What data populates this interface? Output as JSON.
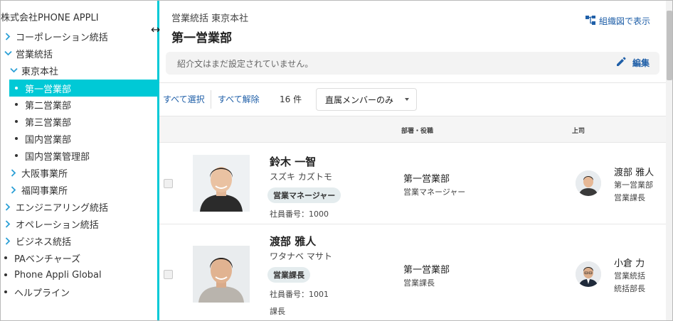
{
  "colors": {
    "accent": "#00c9d6",
    "link": "#1f5fa8",
    "badge_bg": "#e4ecee"
  },
  "sidebar": {
    "root": "株式会社PHONE APPLI",
    "items": [
      {
        "label": "コーポレーション統括",
        "kind": "collapsed"
      },
      {
        "label": "営業統括",
        "kind": "expanded"
      },
      {
        "label": "東京本社",
        "kind": "expanded"
      },
      {
        "label": "第一営業部",
        "kind": "leaf",
        "active": true
      },
      {
        "label": "第二営業部",
        "kind": "leaf"
      },
      {
        "label": "第三営業部",
        "kind": "leaf"
      },
      {
        "label": "国内営業部",
        "kind": "leaf"
      },
      {
        "label": "国内営業管理部",
        "kind": "leaf"
      },
      {
        "label": "大阪事業所",
        "kind": "collapsed"
      },
      {
        "label": "福岡事業所",
        "kind": "collapsed"
      },
      {
        "label": "エンジニアリング統括",
        "kind": "collapsed"
      },
      {
        "label": "オペレーション統括",
        "kind": "collapsed"
      },
      {
        "label": "ビジネス統括",
        "kind": "collapsed"
      },
      {
        "label": "PAベンチャーズ",
        "kind": "leaf"
      },
      {
        "label": "Phone Appli Global",
        "kind": "leaf"
      },
      {
        "label": "ヘルプライン",
        "kind": "leaf"
      }
    ]
  },
  "header": {
    "breadcrumb": "営業統括 東京本社",
    "title": "第一営業部",
    "org_chart_link": "組織図で表示"
  },
  "intro": {
    "text": "紹介文はまだ設定されていません。",
    "edit_label": "編集"
  },
  "toolbar": {
    "select_all": "すべて選択",
    "clear_all": "すべて解除",
    "count": "16 件",
    "filter_value": "直属メンバーのみ"
  },
  "table": {
    "headers": {
      "dept_role": "部署・役職",
      "manager": "上司"
    },
    "rows": [
      {
        "name": "鈴木 一智",
        "kana": "スズキ カズトモ",
        "role_badge": "営業マネージャー",
        "employee_no": "社員番号：1000",
        "extra": "",
        "dept": "第一営業部",
        "position": "営業マネージャー",
        "manager": {
          "name": "渡部 雅人",
          "dept": "第一営業部",
          "position": "営業課長"
        }
      },
      {
        "name": "渡部 雅人",
        "kana": "ワタナベ マサト",
        "role_badge": "営業課長",
        "employee_no": "社員番号：1001",
        "extra": "課長",
        "dept": "第一営業部",
        "position": "営業課長",
        "manager": {
          "name": "小倉 力",
          "dept": "営業統括",
          "position": "統括部長"
        }
      }
    ]
  }
}
